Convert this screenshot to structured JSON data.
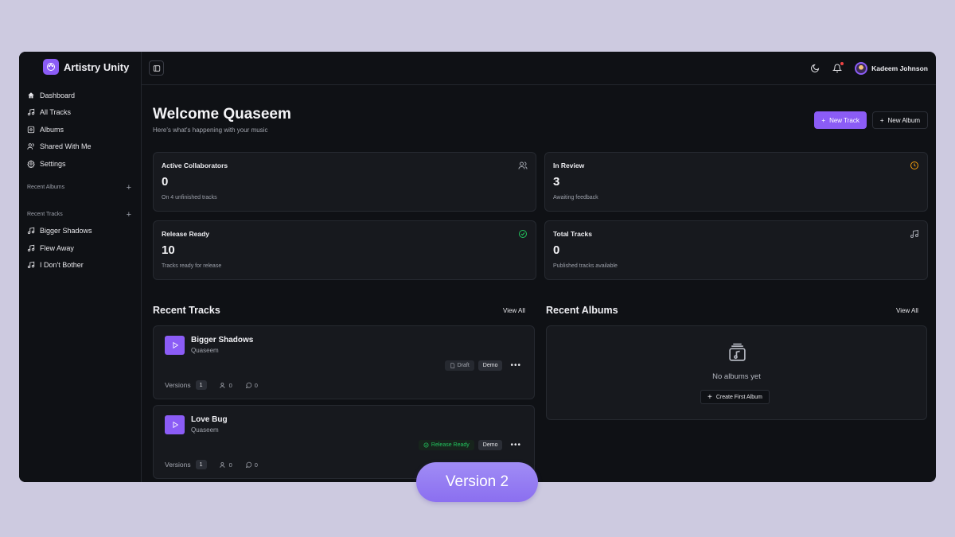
{
  "brand": {
    "name": "Artistry Unity"
  },
  "sidebar": {
    "nav": [
      {
        "label": "Dashboard",
        "icon": "home-icon"
      },
      {
        "label": "All Tracks",
        "icon": "music-note-icon"
      },
      {
        "label": "Albums",
        "icon": "album-icon"
      },
      {
        "label": "Shared With Me",
        "icon": "users-icon"
      },
      {
        "label": "Settings",
        "icon": "gear-icon"
      }
    ],
    "recent_albums_label": "Recent Albums",
    "recent_tracks_label": "Recent Tracks",
    "recent_tracks": [
      {
        "label": "Bigger Shadows"
      },
      {
        "label": "Flew Away"
      },
      {
        "label": "I Don't Bother"
      }
    ]
  },
  "topbar": {
    "user_name": "Kadeem Johnson",
    "has_notification": true
  },
  "header": {
    "title": "Welcome Quaseem",
    "subtitle": "Here's what's happening with your music",
    "new_track_label": "New Track",
    "new_album_label": "New Album"
  },
  "stats": [
    {
      "title": "Active Collaborators",
      "value": "0",
      "desc": "On 4 unfinished tracks",
      "icon": "users-icon"
    },
    {
      "title": "In Review",
      "value": "3",
      "desc": "Awaiting feedback",
      "icon": "clock-icon"
    },
    {
      "title": "Release Ready",
      "value": "10",
      "desc": "Tracks ready for release",
      "icon": "check-circle-icon"
    },
    {
      "title": "Total Tracks",
      "value": "0",
      "desc": "Published tracks available",
      "icon": "music-note-icon"
    }
  ],
  "recent_tracks": {
    "title": "Recent Tracks",
    "view_all": "View All",
    "items": [
      {
        "name": "Bigger Shadows",
        "artist": "Quaseem",
        "status": "Draft",
        "type": "Demo",
        "versions_label": "Versions",
        "versions": "1",
        "collaborators": "0",
        "comments": "0"
      },
      {
        "name": "Love Bug",
        "artist": "Quaseem",
        "status": "Release Ready",
        "type": "Demo",
        "versions_label": "Versions",
        "versions": "1",
        "collaborators": "0",
        "comments": "0"
      }
    ]
  },
  "recent_albums": {
    "title": "Recent Albums",
    "view_all": "View All",
    "empty_text": "No albums yet",
    "create_label": "Create First Album"
  },
  "version_badge": "Version 2",
  "colors": {
    "accent": "#8b5cf6",
    "background": "#0f1115",
    "card": "#17191e",
    "success": "#22c55e",
    "warning": "#f59e0b",
    "frame": "#cdcae0"
  }
}
